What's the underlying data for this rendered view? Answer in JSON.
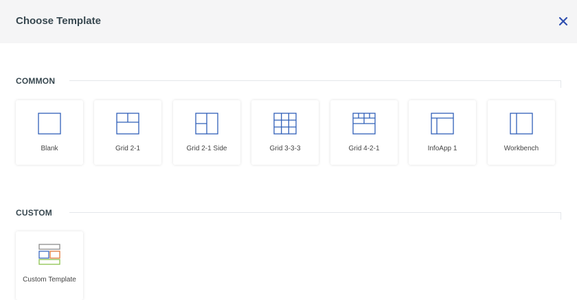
{
  "dialog": {
    "title": "Choose Template",
    "close_icon": "close-icon"
  },
  "colors": {
    "accent": "#2f5fb8",
    "close": "#2f4fb0",
    "custom_top": "#8c8c8c",
    "custom_left": "#3a68c0",
    "custom_right": "#e07a3a",
    "custom_bottom": "#8cc24f"
  },
  "sections": {
    "common": {
      "label": "COMMON",
      "templates": [
        {
          "label": "Blank",
          "icon": "blank-layout-icon"
        },
        {
          "label": "Grid 2-1",
          "icon": "grid-2-1-icon"
        },
        {
          "label": "Grid 2-1 Side",
          "icon": "grid-2-1-side-icon"
        },
        {
          "label": "Grid 3-3-3",
          "icon": "grid-3-3-3-icon"
        },
        {
          "label": "Grid 4-2-1",
          "icon": "grid-4-2-1-icon"
        },
        {
          "label": "InfoApp 1",
          "icon": "infoapp-1-icon"
        },
        {
          "label": "Workbench",
          "icon": "workbench-icon"
        }
      ]
    },
    "custom": {
      "label": "CUSTOM",
      "templates": [
        {
          "label": "Custom Template",
          "icon": "custom-template-icon"
        }
      ]
    }
  }
}
